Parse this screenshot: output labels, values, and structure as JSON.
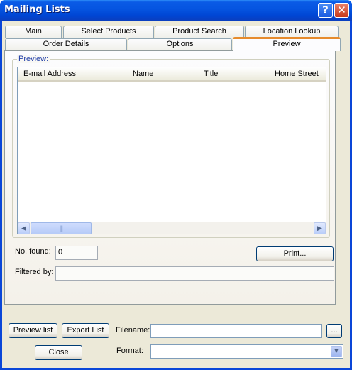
{
  "window": {
    "title": "Mailing Lists",
    "help_icon": "question-mark-icon",
    "close_icon": "close-x-icon"
  },
  "tabs": {
    "row_back": [
      "Main",
      "Select Products",
      "Product Search",
      "Location Lookup"
    ],
    "row_front": [
      "Order Details",
      "Options",
      "Preview"
    ],
    "active": "Preview"
  },
  "preview": {
    "group_label": "Preview:",
    "columns": [
      "E-mail Address",
      "Name",
      "Title",
      "Home Street"
    ],
    "rows": [],
    "no_found_label": "No. found:",
    "no_found_value": "0",
    "print_button": "Print...",
    "filtered_by_label": "Filtered by:",
    "filtered_by_value": ""
  },
  "footer": {
    "preview_list_button": "Preview list",
    "export_list_button": "Export List",
    "close_button": "Close",
    "filename_label": "Filename:",
    "filename_value": "",
    "browse_button": "...",
    "format_label": "Format:",
    "format_value": ""
  },
  "colors": {
    "titlebar": "#0554e0",
    "dialog_face": "#ece9d8",
    "active_tab_accent": "#e68b2c",
    "group_label": "#1f3da7"
  }
}
